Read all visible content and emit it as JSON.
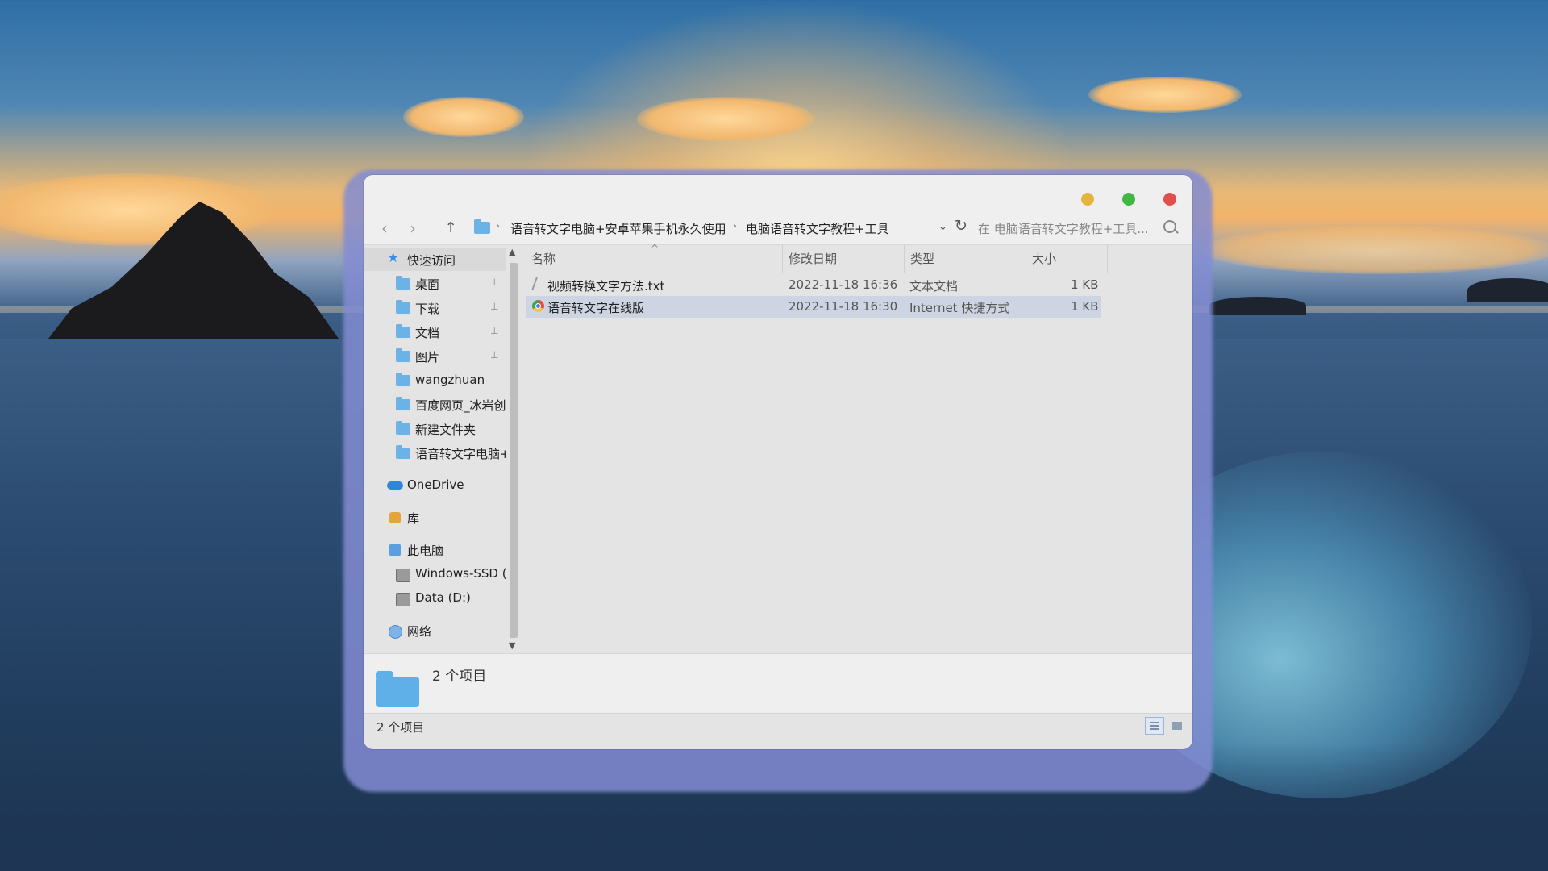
{
  "toolbar": {
    "back_icon": "‹",
    "forward_icon": "›",
    "up_icon": "↑",
    "breadcrumb": [
      "语音转文字电脑+安卓苹果手机永久使用",
      "电脑语音转文字教程+工具"
    ],
    "separator": "›",
    "dropdown_icon": "⌄",
    "refresh_icon": "↻",
    "search_placeholder": "在 电脑语音转文字教程+工具..."
  },
  "sidebar": {
    "quick_access": "快速访问",
    "quick_items": [
      {
        "label": "桌面",
        "pinned": true
      },
      {
        "label": "下载",
        "pinned": true
      },
      {
        "label": "文档",
        "pinned": true
      },
      {
        "label": "图片",
        "pinned": true
      },
      {
        "label": "wangzhuan",
        "pinned": false
      },
      {
        "label": "百度网页_冰岩创",
        "pinned": false
      },
      {
        "label": "新建文件夹",
        "pinned": false
      },
      {
        "label": "语音转文字电脑+",
        "pinned": false
      }
    ],
    "pin_icon": "📌",
    "onedrive": "OneDrive",
    "library": "库",
    "this_pc": "此电脑",
    "drives": [
      "Windows-SSD (",
      "Data (D:)"
    ],
    "network": "网络"
  },
  "columns": {
    "name": "名称",
    "date": "修改日期",
    "type": "类型",
    "size": "大小",
    "sort_icon": "^"
  },
  "files": [
    {
      "name": "视频转换文字方法.txt",
      "date": "2022-11-18 16:36",
      "type": "文本文档",
      "size": "1 KB",
      "icon": "text-file-icon"
    },
    {
      "name": "语音转文字在线版",
      "date": "2022-11-18 16:30",
      "type": "Internet 快捷方式",
      "size": "1 KB",
      "icon": "internet-shortcut-icon"
    }
  ],
  "details": {
    "count_text": "2 个项目"
  },
  "status": {
    "count_text": "2 个项目"
  }
}
